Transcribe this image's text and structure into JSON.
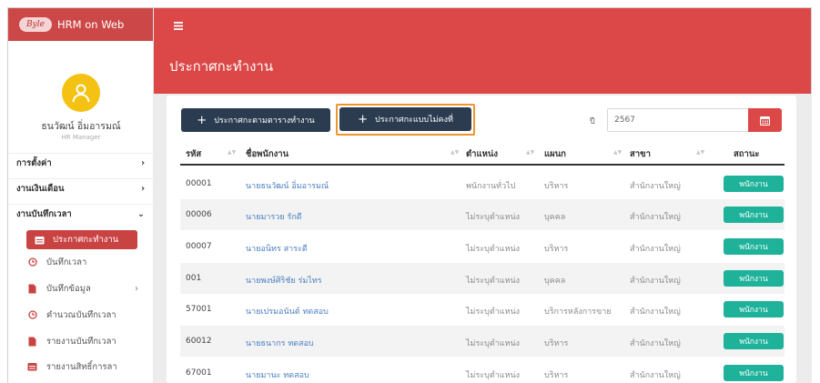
{
  "app": {
    "logo_text": "Byle",
    "name": "HRM on Web"
  },
  "user": {
    "name": "ธนวัฒน์ อิ่มอารมณ์",
    "role": "HR Manager"
  },
  "sidebar": {
    "sections": [
      {
        "label": "การตั้งค่า",
        "chevron": "›"
      },
      {
        "label": "งานเงินเดือน",
        "chevron": "›"
      },
      {
        "label": "งานบันทึกเวลา",
        "chevron": "⌄"
      }
    ],
    "active_item": {
      "label": "ประกาศกะทำงาน",
      "icon": "calendar-icon"
    },
    "sub_items": [
      {
        "label": "บันทึกเวลา",
        "icon": "clock-icon"
      },
      {
        "label": "บันทึกข้อมูล",
        "icon": "file-icon",
        "chevron": "›"
      },
      {
        "label": "คำนวณบันทึกเวลา",
        "icon": "clock-icon"
      },
      {
        "label": "รายงานบันทึกเวลา",
        "icon": "file-icon"
      },
      {
        "label": "รายงานสิทธิ์การลา",
        "icon": "calendar-icon"
      }
    ]
  },
  "header": {
    "menu_icon": "menu-icon",
    "title": "ประกาศกะทำงาน"
  },
  "toolbar": {
    "btn_schedule": "ประกาศกะตามตารางทำงาน",
    "btn_irregular": "ประกาศกะแบบไม่คงที่",
    "year_label": "ปี",
    "year_value": "2567",
    "highlight_color": "#f0952b"
  },
  "table": {
    "headers": {
      "code": "รหัส",
      "name": "ชื่อพนักงาน",
      "position": "ตำแหน่ง",
      "department": "แผนก",
      "branch": "สาขา",
      "status": "สถานะ"
    },
    "rows": [
      {
        "code": "00001",
        "name": "นายธนวัฒน์ อิ่มอารมณ์",
        "position": "พนักงานทั่วไป",
        "department": "บริหาร",
        "branch": "สำนักงานใหญ่",
        "status": "พนักงาน"
      },
      {
        "code": "00006",
        "name": "นายมารวย รักดี",
        "position": "ไม่ระบุตำแหน่ง",
        "department": "บุคคล",
        "branch": "สำนักงานใหญ่",
        "status": "พนักงาน"
      },
      {
        "code": "00007",
        "name": "นายอนิทร สาระดี",
        "position": "ไม่ระบุตำแหน่ง",
        "department": "บริหาร",
        "branch": "สำนักงานใหญ่",
        "status": "พนักงาน"
      },
      {
        "code": "001",
        "name": "นายพงษ์ศิริชัย ร่มไทร",
        "position": "ไม่ระบุตำแหน่ง",
        "department": "บุคคล",
        "branch": "สำนักงานใหญ่",
        "status": "พนักงาน"
      },
      {
        "code": "57001",
        "name": "นายเปรมอนันต์ ทดสอบ",
        "position": "ไม่ระบุตำแหน่ง",
        "department": "บริการหลังการขาย",
        "branch": "สำนักงานใหญ่",
        "status": "พนักงาน"
      },
      {
        "code": "60012",
        "name": "นายธนากร ทดสอบ",
        "position": "ไม่ระบุตำแหน่ง",
        "department": "บริหาร",
        "branch": "สำนักงานใหญ่",
        "status": "พนักงาน"
      },
      {
        "code": "67001",
        "name": "นายมานะ ทดสอบ",
        "position": "ไม่ระบุตำแหน่ง",
        "department": "บริหาร",
        "branch": "สำนักงานใหญ่",
        "status": "พนักงาน"
      }
    ]
  },
  "colors": {
    "brand_red": "#dc4747",
    "nav_active": "#c94343",
    "dark_button": "#2b3c50",
    "status_green": "#1fb29a",
    "link_blue": "#4a7fc1"
  }
}
